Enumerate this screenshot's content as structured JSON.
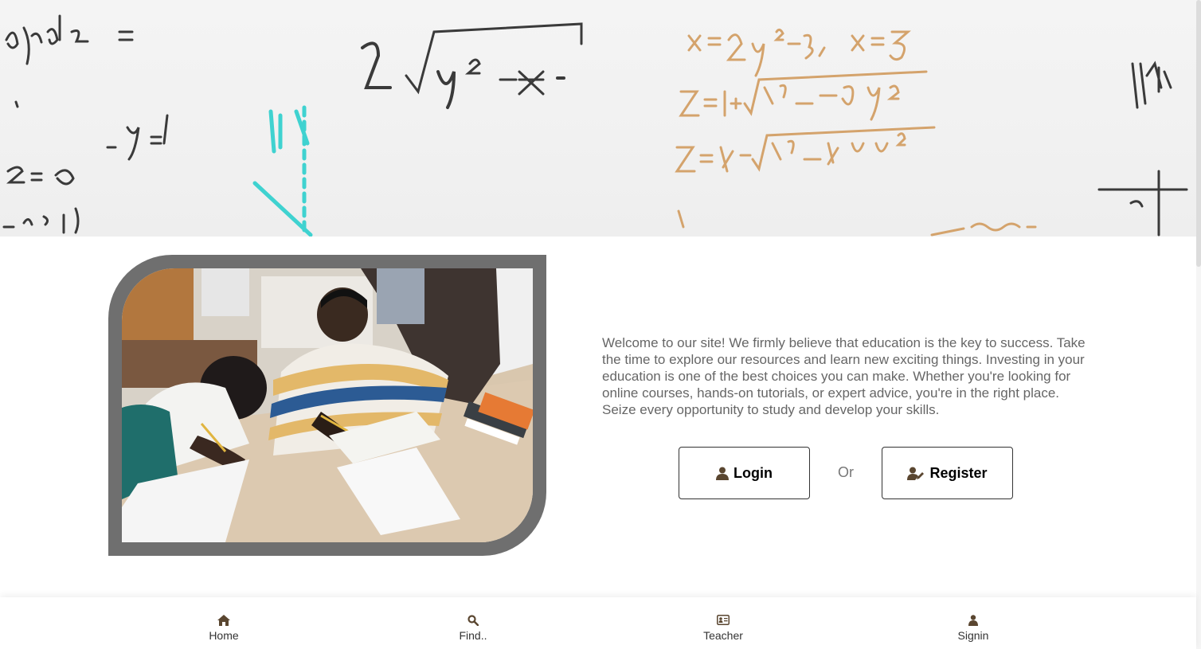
{
  "welcome": {
    "text": "Welcome to our site! We firmly believe that education is the key to success. Take the time to explore our resources and learn new exciting things. Investing in your education is one of the best choices you can make. Whether you're looking for online courses, hands-on tutorials, or expert advice, you're in the right place. Seize every opportunity to study and develop your skills."
  },
  "actions": {
    "login_label": "Login",
    "or_label": "Or",
    "register_label": "Register"
  },
  "nav": {
    "items": [
      {
        "label": "Home",
        "icon": "home-icon"
      },
      {
        "label": "Find..",
        "icon": "search-icon"
      },
      {
        "label": "Teacher",
        "icon": "id-card-icon"
      },
      {
        "label": "Signin",
        "icon": "user-icon"
      }
    ]
  },
  "colors": {
    "icon": "#5a4630",
    "frame": "#6f6f6f",
    "text": "#666666"
  }
}
